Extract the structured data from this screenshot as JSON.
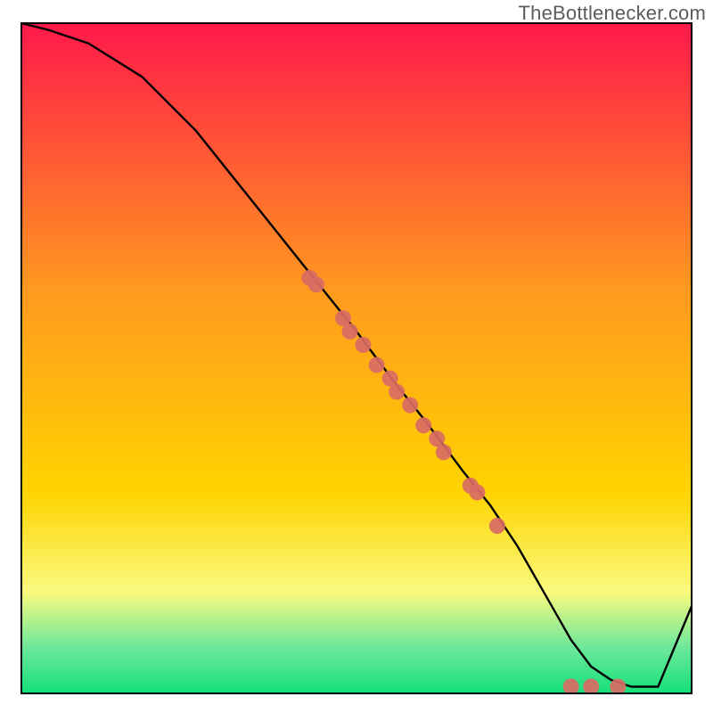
{
  "watermark": "TheBottlenecker.com",
  "chart_data": {
    "type": "line",
    "title": "",
    "xlabel": "",
    "ylabel": "",
    "xlim": [
      0,
      100
    ],
    "ylim": [
      0,
      100
    ],
    "grid": false,
    "background_gradient": {
      "top_color": "#ff1a4a",
      "mid_color": "#ffd400",
      "low_band_color": "#f8f97a",
      "bottom_color": "#15e07a"
    },
    "series": [
      {
        "name": "bottleneck-curve",
        "color": "#000000",
        "x": [
          0,
          4,
          10,
          18,
          26,
          34,
          42,
          50,
          56,
          60,
          66,
          70,
          74,
          78,
          82,
          85,
          88,
          91,
          93,
          95,
          100
        ],
        "y": [
          100,
          99,
          97,
          92,
          84,
          74,
          64,
          54,
          46,
          41,
          33,
          28,
          22,
          15,
          8,
          4,
          2,
          1,
          1,
          1,
          13
        ]
      }
    ],
    "scatter": [
      {
        "name": "gpu-points",
        "color": "#d96b64",
        "radius": 9,
        "points": [
          {
            "x": 43,
            "y": 62
          },
          {
            "x": 44,
            "y": 61
          },
          {
            "x": 48,
            "y": 56
          },
          {
            "x": 49,
            "y": 54
          },
          {
            "x": 51,
            "y": 52
          },
          {
            "x": 53,
            "y": 49
          },
          {
            "x": 55,
            "y": 47
          },
          {
            "x": 56,
            "y": 45
          },
          {
            "x": 58,
            "y": 43
          },
          {
            "x": 60,
            "y": 40
          },
          {
            "x": 62,
            "y": 38
          },
          {
            "x": 63,
            "y": 36
          },
          {
            "x": 67,
            "y": 31
          },
          {
            "x": 68,
            "y": 30
          },
          {
            "x": 71,
            "y": 25
          },
          {
            "x": 82,
            "y": 1
          },
          {
            "x": 85,
            "y": 1
          },
          {
            "x": 89,
            "y": 1
          }
        ]
      }
    ]
  }
}
